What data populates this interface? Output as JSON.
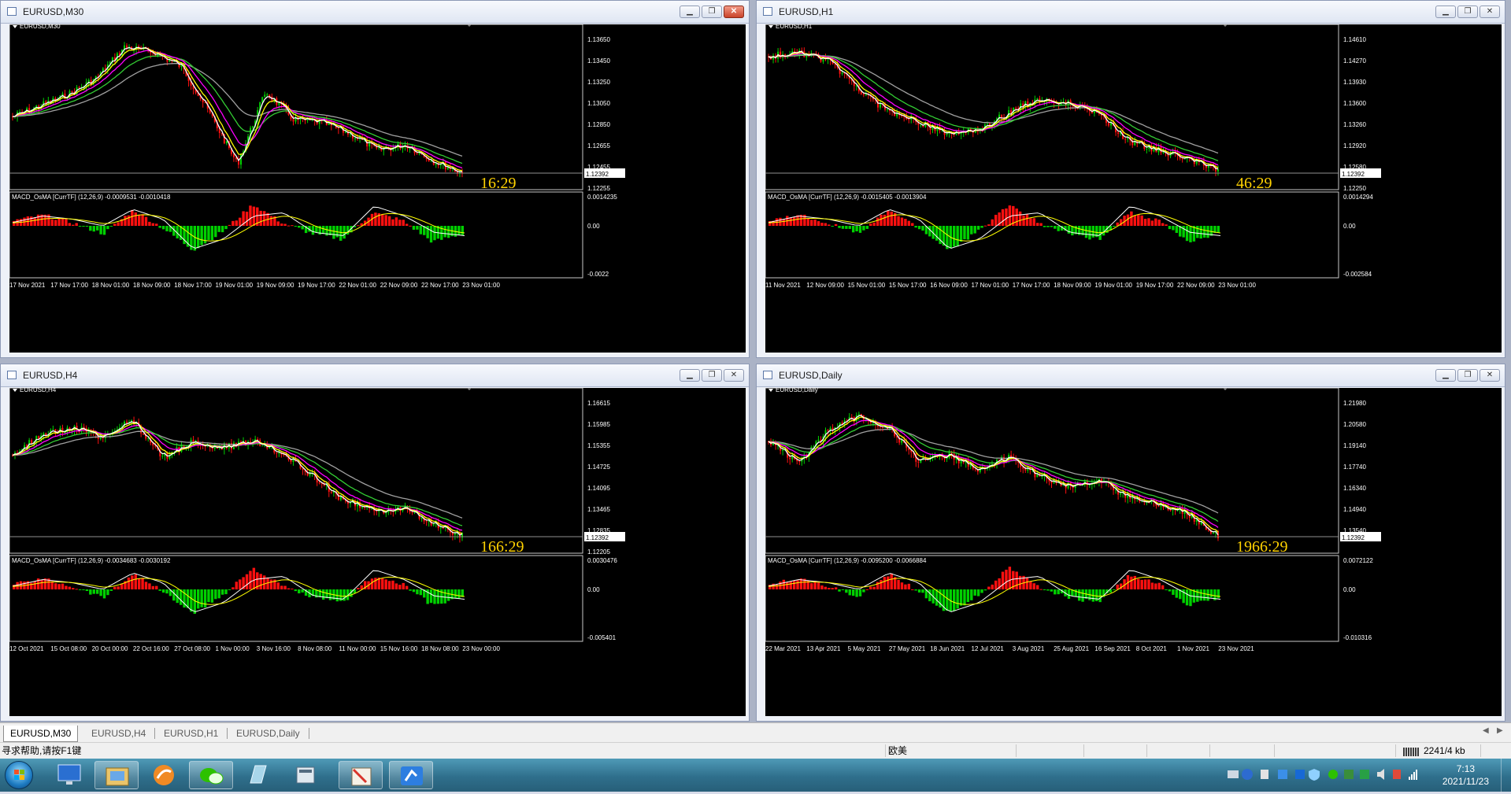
{
  "windows": [
    {
      "id": "m30",
      "title": "EURUSD,M30",
      "symbol_label": "EURUSD,M30",
      "indicator_label": "MACD_OsMA [CurrTF] (12,26,9) -0.0009531 -0.0010418",
      "price_axis": [
        "1.13650",
        "1.13450",
        "1.13250",
        "1.13050",
        "1.12850",
        "1.12655",
        "1.12455",
        "1.12255"
      ],
      "current_price": "1.12392",
      "macd_axis": [
        "0.0014235",
        "0.00",
        "-0.0022"
      ],
      "timer": "16:29",
      "time_axis": [
        "17 Nov 2021",
        "17 Nov 17:00",
        "18 Nov 01:00",
        "18 Nov 09:00",
        "18 Nov 17:00",
        "19 Nov 01:00",
        "19 Nov 09:00",
        "19 Nov 17:00",
        "22 Nov 01:00",
        "22 Nov 09:00",
        "22 Nov 17:00",
        "23 Nov 01:00"
      ],
      "active": true
    },
    {
      "id": "h1",
      "title": "EURUSD,H1",
      "symbol_label": "EURUSD,H1",
      "indicator_label": "MACD_OsMA [CurrTF] (12,26,9) -0.0015405 -0.0013904",
      "price_axis": [
        "1.14610",
        "1.14270",
        "1.13930",
        "1.13600",
        "1.13260",
        "1.12920",
        "1.12580",
        "1.12250"
      ],
      "current_price": "1.12392",
      "macd_axis": [
        "0.0014294",
        "0.00",
        "-0.002584"
      ],
      "timer": "46:29",
      "time_axis": [
        "11 Nov 2021",
        "12 Nov 09:00",
        "15 Nov 01:00",
        "15 Nov 17:00",
        "16 Nov 09:00",
        "17 Nov 01:00",
        "17 Nov 17:00",
        "18 Nov 09:00",
        "19 Nov 01:00",
        "19 Nov 17:00",
        "22 Nov 09:00",
        "23 Nov 01:00"
      ],
      "active": false
    },
    {
      "id": "h4",
      "title": "EURUSD,H4",
      "symbol_label": "EURUSD,H4",
      "indicator_label": "MACD_OsMA [CurrTF] (12,26,9) -0.0034683 -0.0030192",
      "price_axis": [
        "1.16615",
        "1.15985",
        "1.15355",
        "1.14725",
        "1.14095",
        "1.13465",
        "1.12835",
        "1.12205"
      ],
      "current_price": "1.12392",
      "macd_axis": [
        "0.0030476",
        "0.00",
        "-0.005401"
      ],
      "timer": "166:29",
      "time_axis": [
        "12 Oct 2021",
        "15 Oct 08:00",
        "20 Oct 00:00",
        "22 Oct 16:00",
        "27 Oct 08:00",
        "1 Nov 00:00",
        "3 Nov 16:00",
        "8 Nov 08:00",
        "11 Nov 00:00",
        "15 Nov 16:00",
        "18 Nov 08:00",
        "23 Nov 00:00"
      ],
      "active": false
    },
    {
      "id": "daily",
      "title": "EURUSD,Daily",
      "symbol_label": "EURUSD,Daily",
      "indicator_label": "MACD_OsMA [CurrTF] (12,26,9) -0.0095200 -0.0066884",
      "price_axis": [
        "1.21980",
        "1.20580",
        "1.19140",
        "1.17740",
        "1.16340",
        "1.14940",
        "1.13540",
        ""
      ],
      "current_price": "1.12392",
      "macd_axis": [
        "0.0072122",
        "0.00",
        "-0.010316"
      ],
      "timer": "1966:29",
      "time_axis": [
        "22 Mar 2021",
        "13 Apr 2021",
        "5 May 2021",
        "27 May 2021",
        "18 Jun 2021",
        "12 Jul 2021",
        "3 Aug 2021",
        "25 Aug 2021",
        "16 Sep 2021",
        "8 Oct 2021",
        "1 Nov 2021",
        "23 Nov 2021"
      ],
      "active": false
    }
  ],
  "tabs": [
    "EURUSD,M30",
    "EURUSD,H4",
    "EURUSD,H1",
    "EURUSD,Daily"
  ],
  "active_tab": 0,
  "status": {
    "help": "寻求帮助,请按F1键",
    "profile": "欧美",
    "traffic": "2241/4 kb"
  },
  "taskbar": {
    "time": "7:13",
    "date": "2021/11/23",
    "apps": [
      "start-orb",
      "desktop",
      "explorer",
      "browser",
      "wechat",
      "notebook",
      "calculator",
      "paint",
      "metatrader"
    ]
  },
  "colors": {
    "chart_bg": "#000000",
    "bull": "#00d000",
    "bear": "#ff1010",
    "ma_fast": "#ffffff",
    "ma_yellow": "#ffff00",
    "ma_magenta": "#ff00ff",
    "ma_green": "#33cc33",
    "ma_gray": "#a0a0a0",
    "timer": "#ffd200"
  }
}
